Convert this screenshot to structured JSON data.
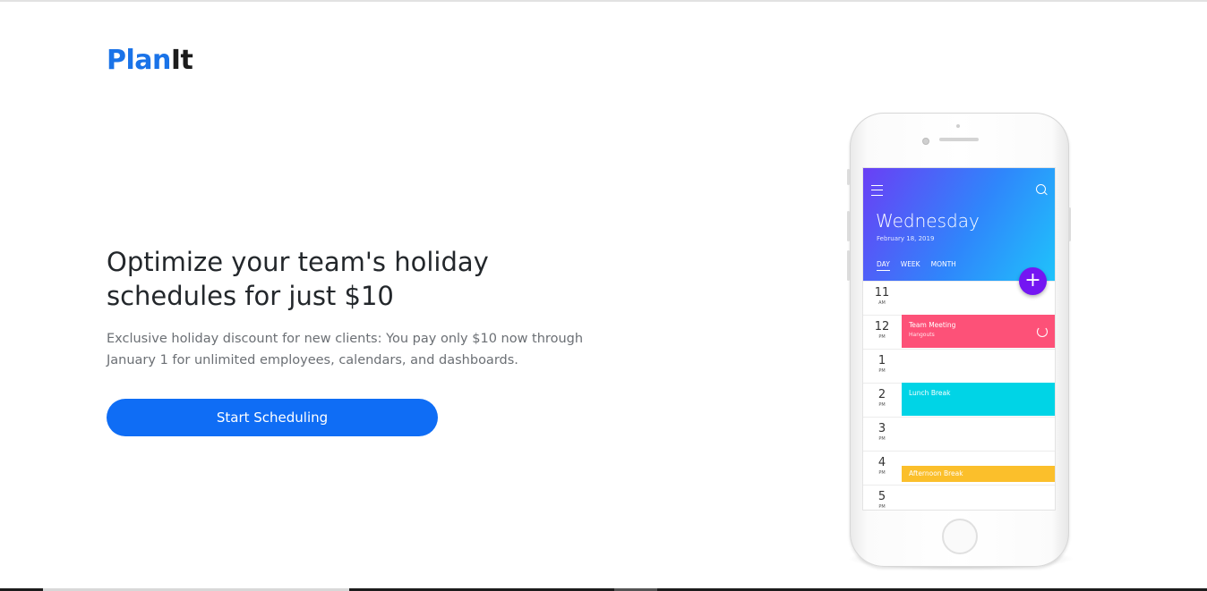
{
  "brand": {
    "part1": "Plan",
    "part2": "It"
  },
  "hero": {
    "headline": "Optimize your team's holiday schedules for just $10",
    "subtext": "Exclusive holiday discount for new clients: You pay only $10 now through January 1 for unlimited employees, calendars, and dashboards.",
    "cta_label": "Start Scheduling"
  },
  "phone": {
    "day": "Wednesday",
    "date": "February 18, 2019",
    "tabs": [
      "DAY",
      "WEEK",
      "MONTH"
    ],
    "fab_label": "+",
    "hours": [
      {
        "h": "11",
        "p": "AM"
      },
      {
        "h": "12",
        "p": "PM"
      },
      {
        "h": "1",
        "p": "PM"
      },
      {
        "h": "2",
        "p": "PM"
      },
      {
        "h": "3",
        "p": "PM"
      },
      {
        "h": "4",
        "p": "PM"
      },
      {
        "h": "5",
        "p": "PM"
      }
    ],
    "events": [
      {
        "title": "Team Meeting",
        "subtitle": "Hangouts",
        "color": "#fd5178"
      },
      {
        "title": "Lunch Break",
        "subtitle": "",
        "color": "#00d4e6"
      },
      {
        "title": "Afternoon Break",
        "subtitle": "",
        "color": "#fbbf2b"
      }
    ],
    "icons": [
      "menu-icon",
      "search-icon",
      "plus-icon",
      "repeat-icon"
    ]
  },
  "colors": {
    "brand_blue": "#1a73e8",
    "cta_blue": "#0f6df5"
  }
}
